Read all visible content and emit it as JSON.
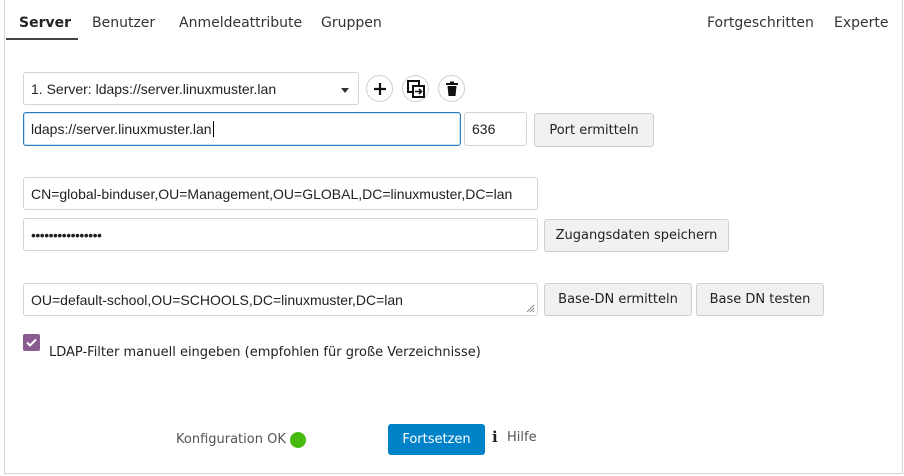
{
  "tabs": [
    {
      "label": "Server"
    },
    {
      "label": "Benutzer"
    },
    {
      "label": "Anmeldeattribute"
    },
    {
      "label": "Gruppen"
    },
    {
      "label": "Fortgeschritten"
    },
    {
      "label": "Experte"
    }
  ],
  "server": {
    "selected": "1. Server: ldaps://server.linuxmuster.lan",
    "host": "ldaps://server.linuxmuster.lan",
    "port": "636",
    "detect_port_label": "Port ermitteln",
    "icons": [
      "add-icon",
      "copy-icon",
      "delete-icon"
    ]
  },
  "credentials": {
    "bind_dn": "CN=global-binduser,OU=Management,OU=GLOBAL,DC=linuxmuster,DC=lan",
    "password_mask": "••••••••••••••••",
    "save_label": "Zugangsdaten speichern"
  },
  "base": {
    "base_dn": "OU=default-school,OU=SCHOOLS,DC=linuxmuster,DC=lan",
    "detect_label": "Base-DN ermitteln",
    "test_label": "Base DN testen"
  },
  "filter_manual": {
    "checked": true,
    "label": "LDAP-Filter manuell eingeben (empfohlen für große Verzeichnisse)"
  },
  "footer": {
    "status": "Konfiguration OK",
    "status_color": "#46ba10",
    "continue_label": "Fortsetzen",
    "help_label": "Hilfe"
  },
  "colors": {
    "primary": "#0082c9",
    "checkbox": "#8a5b90",
    "focus": "#2a7bbf"
  }
}
